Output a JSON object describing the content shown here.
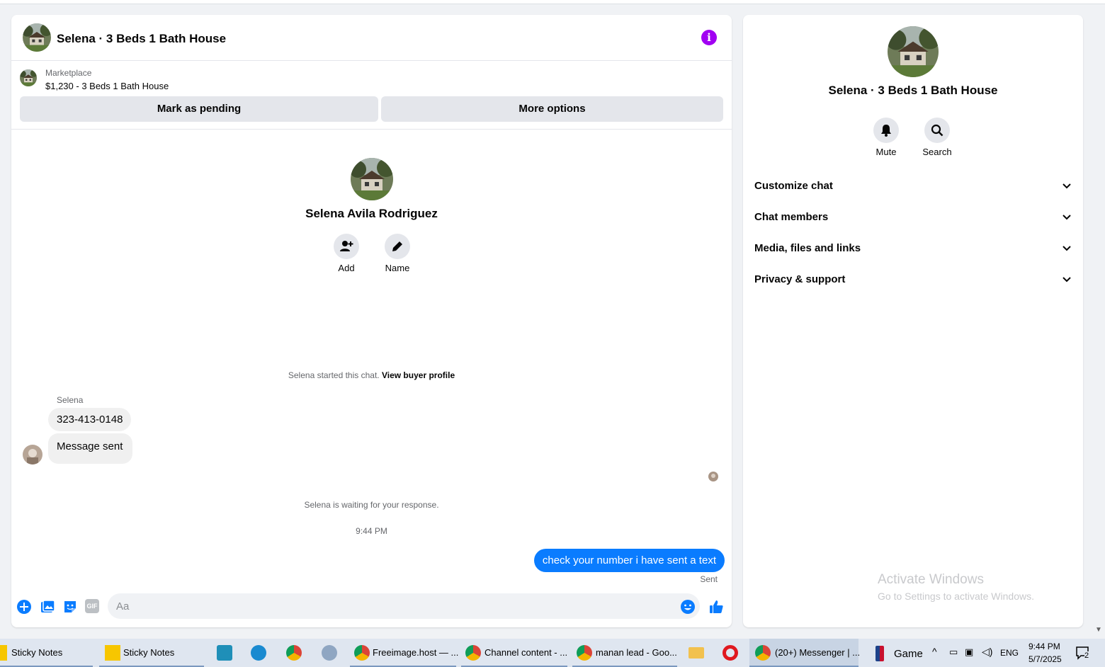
{
  "chat": {
    "title": "Selena · 3 Beds 1 Bath House",
    "info_icon": "info-icon",
    "marketplace": {
      "label": "Marketplace",
      "item": "$1,230 - 3 Beds 1 Bath House",
      "mark_pending": "Mark as pending",
      "more_options": "More options"
    },
    "profile": {
      "name": "Selena Avila Rodriguez",
      "add_label": "Add",
      "name_label": "Name"
    },
    "started_text": "Selena started this chat.",
    "view_buyer_profile": "View buyer profile",
    "messages": {
      "sender": "Selena",
      "incoming": [
        "323-413-0148",
        "Message sent"
      ],
      "waiting_text": "Selena is waiting for your response.",
      "time": "9:44 PM",
      "outgoing": "check your number i have sent a text",
      "status": "Sent"
    },
    "composer": {
      "placeholder": "Aa",
      "gif_label": "GIF"
    },
    "accent_color": "#0a7cff",
    "info_color": "#a100f2"
  },
  "info_panel": {
    "name": "Selena · 3 Beds 1 Bath House",
    "mute_label": "Mute",
    "search_label": "Search",
    "sections": [
      "Customize chat",
      "Chat members",
      "Media, files and links",
      "Privacy & support"
    ]
  },
  "watermark": {
    "title": "Activate Windows",
    "subtitle": "Go to Settings to activate Windows."
  },
  "taskbar": {
    "items": [
      "Sticky Notes",
      "Sticky Notes",
      "Freeimage.host — ...",
      "Channel content - ...",
      "manan lead - Goo...",
      "(20+) Messenger | ..."
    ],
    "game_label": "Game",
    "lang": "ENG",
    "time": "9:44 PM",
    "date": "5/7/2025",
    "notification_count": "2"
  }
}
